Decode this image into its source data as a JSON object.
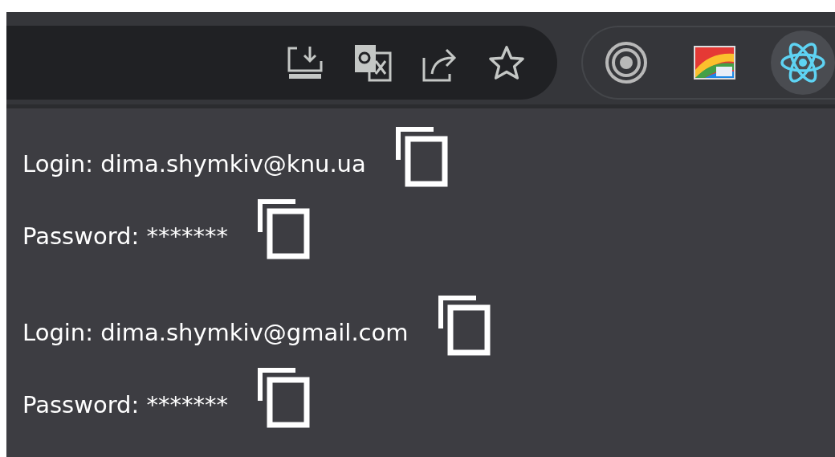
{
  "toolbar": {
    "omnibox_icons": [
      {
        "kind": "install"
      },
      {
        "kind": "translate"
      },
      {
        "kind": "share"
      },
      {
        "kind": "bookmark"
      }
    ],
    "extensions": [
      {
        "kind": "rings",
        "selected": false
      },
      {
        "kind": "rainbow",
        "selected": false
      },
      {
        "kind": "atom",
        "selected": true
      }
    ]
  },
  "accounts": [
    {
      "login": "Login: dima.shymkiv@knu.ua",
      "password": "Password: *******"
    },
    {
      "login": "Login: dima.shymkiv@gmail.com",
      "password": "Password: *******"
    }
  ]
}
